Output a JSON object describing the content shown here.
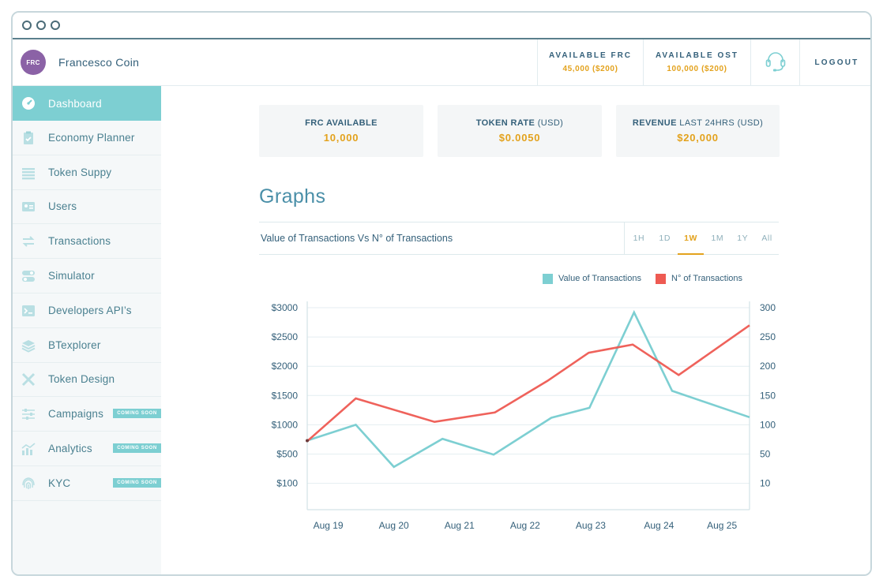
{
  "app": {
    "name": "Francesco Coin",
    "avatar_text": "FRC"
  },
  "header": {
    "stats": [
      {
        "label": "AVAILABLE FRC",
        "value": "45,000 ($200)"
      },
      {
        "label": "AVAILABLE OST",
        "value": "100,000 ($200)"
      }
    ],
    "support_icon": "headset-icon",
    "logout_label": "LOGOUT"
  },
  "sidebar": {
    "coming_soon_label": "COMING SOON",
    "items": [
      {
        "label": "Dashboard",
        "icon": "dashboard-gauge-icon",
        "active": true
      },
      {
        "label": "Economy Planner",
        "icon": "clipboard-check-icon"
      },
      {
        "label": "Token Suppy",
        "icon": "token-supply-icon"
      },
      {
        "label": "Users",
        "icon": "id-card-icon"
      },
      {
        "label": "Transactions",
        "icon": "swap-arrows-icon"
      },
      {
        "label": "Simulator",
        "icon": "toggle-switches-icon"
      },
      {
        "label": "Developers API’s",
        "icon": "terminal-icon"
      },
      {
        "label": "BTexplorer",
        "icon": "layers-icon"
      },
      {
        "label": "Token Design",
        "icon": "design-tools-icon"
      },
      {
        "label": "Campaigns",
        "icon": "sliders-icon",
        "coming_soon": true
      },
      {
        "label": "Analytics",
        "icon": "analytics-chart-icon",
        "coming_soon": true
      },
      {
        "label": "KYC",
        "icon": "fingerprint-icon",
        "coming_soon": true
      }
    ]
  },
  "cards": [
    {
      "label_bold": "FRC AVAILABLE",
      "label_rest": "",
      "value": "10,000"
    },
    {
      "label_bold": "TOKEN RATE",
      "label_rest": " (USD)",
      "value": "$0.0050"
    },
    {
      "label_bold": "REVENUE",
      "label_rest": " LAST 24HRS (USD)",
      "value": "$20,000"
    }
  ],
  "graphs": {
    "heading": "Graphs",
    "chart_title": "Value of Transactions Vs N° of Transactions",
    "ranges": [
      "1H",
      "1D",
      "1W",
      "1M",
      "1Y",
      "All"
    ],
    "active_range": "1W"
  },
  "colors": {
    "accent": "#7dcfd2",
    "gold": "#e3a21d",
    "value_series": "#7dcfd2",
    "count_series": "#ee5a52",
    "avatar": "#8b62a6"
  },
  "chart_data": {
    "type": "line",
    "x": [
      "Aug 19",
      "",
      "Aug 20",
      "",
      "Aug 21",
      "",
      "Aug 22",
      "",
      "Aug 23",
      "",
      "Aug 24",
      "",
      "Aug 25",
      ""
    ],
    "x_tick_labels": [
      "Aug 19",
      "Aug 20",
      "Aug 21",
      "Aug 22",
      "Aug 23",
      "Aug 24",
      "Aug 25"
    ],
    "series": [
      {
        "name": "Value of Transactions",
        "axis": "left",
        "color": "#7dcfd2",
        "points": [
          [
            0,
            730
          ],
          [
            0.74,
            1000
          ],
          [
            1.32,
            280
          ],
          [
            2.06,
            760
          ],
          [
            2.84,
            490
          ],
          [
            3.72,
            1120
          ],
          [
            4.3,
            1290
          ],
          [
            4.98,
            2920
          ],
          [
            5.56,
            1580
          ],
          [
            6.74,
            1130
          ]
        ]
      },
      {
        "name": "N° of Transactions",
        "axis": "right",
        "color": "#ee5a52",
        "points": [
          [
            0,
            72
          ],
          [
            0.74,
            145
          ],
          [
            1.94,
            105
          ],
          [
            2.86,
            121
          ],
          [
            3.66,
            175
          ],
          [
            4.29,
            223
          ],
          [
            4.96,
            237
          ],
          [
            5.66,
            185
          ],
          [
            6.74,
            270
          ]
        ]
      }
    ],
    "left_axis": {
      "ticks": [
        "$3000",
        "$2500",
        "$2000",
        "$1500",
        "$1000",
        "$500",
        "$100"
      ],
      "tick_values": [
        3000,
        2500,
        2000,
        1500,
        1000,
        500,
        0
      ],
      "range": [
        -450,
        3000
      ]
    },
    "right_axis": {
      "ticks": [
        "300",
        "250",
        "200",
        "150",
        "100",
        "50",
        "10"
      ],
      "tick_values": [
        300,
        250,
        200,
        150,
        100,
        50,
        0
      ],
      "range": [
        -45,
        300
      ]
    },
    "x_range": [
      0,
      6.74
    ],
    "x_tick_positions": [
      0.32,
      1.32,
      2.32,
      3.32,
      4.32,
      5.36,
      6.32
    ],
    "legend": "top-right",
    "grid": "horizontal"
  }
}
